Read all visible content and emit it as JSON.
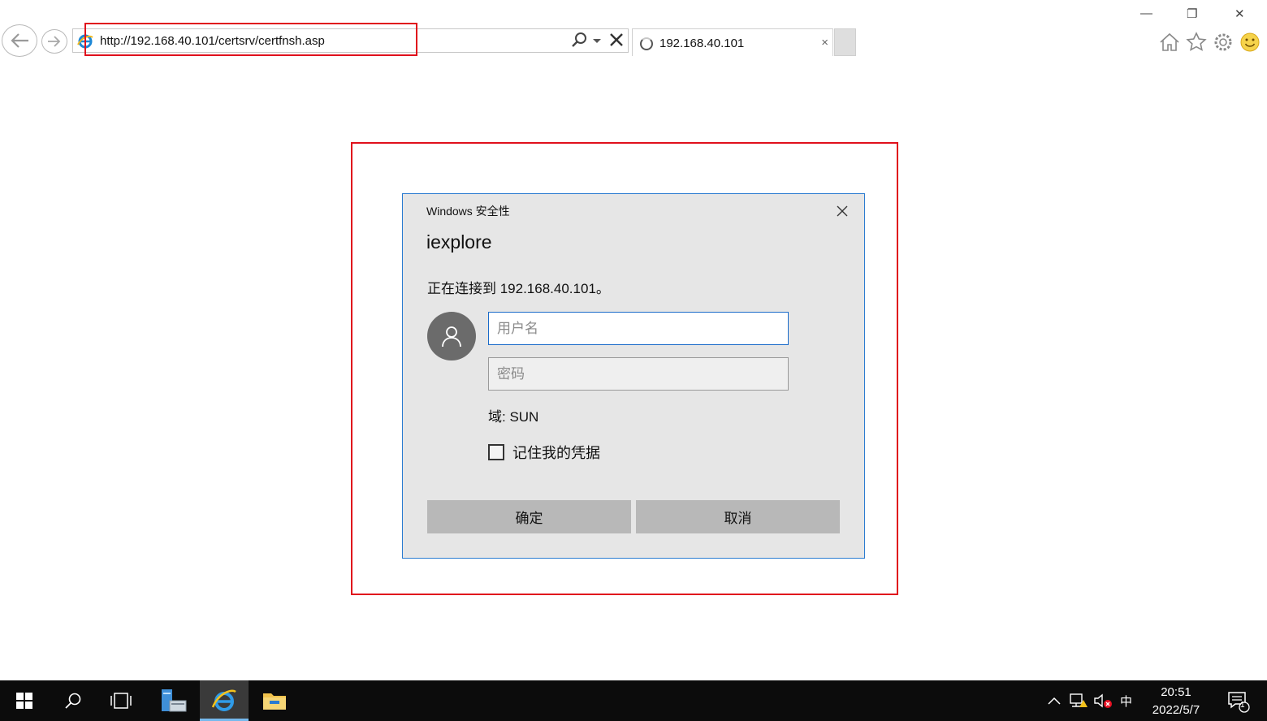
{
  "browser": {
    "address_url": "http://192.168.40.101/certsrv/certfnsh.asp",
    "tab_title": "192.168.40.101",
    "icons": [
      "back-icon",
      "forward-icon",
      "ie-favicon-icon",
      "search-icon",
      "dropdown-icon",
      "stop-icon",
      "loading-icon",
      "tab-close-icon",
      "minimize-icon",
      "restore-icon",
      "close-icon",
      "home-icon",
      "favorites-star-icon",
      "settings-gear-icon",
      "feedback-smiley-icon"
    ],
    "window_controls": {
      "minimize": "—",
      "restore": "❐",
      "close": "✕"
    },
    "tab_close": "×"
  },
  "dialog": {
    "title": "Windows 安全性",
    "app_name": "iexplore",
    "message": "正在连接到 192.168.40.101。",
    "username_placeholder": "用户名",
    "password_placeholder": "密码",
    "domain_label": "域: SUN",
    "remember_label": "记住我的凭据",
    "remember_checked": false,
    "ok_label": "确定",
    "cancel_label": "取消",
    "accent_color": "#1a6bc9"
  },
  "annotations": {
    "highlight_color": "#e0101c"
  },
  "taskbar": {
    "items": [
      "windows-start-icon",
      "search-icon",
      "task-view-icon",
      "server-manager-icon",
      "internet-explorer-icon",
      "file-explorer-icon"
    ],
    "active_item": "internet-explorer-icon",
    "ime": "中",
    "time": "20:51",
    "date": "2022/5/7",
    "notification_count": "1"
  }
}
